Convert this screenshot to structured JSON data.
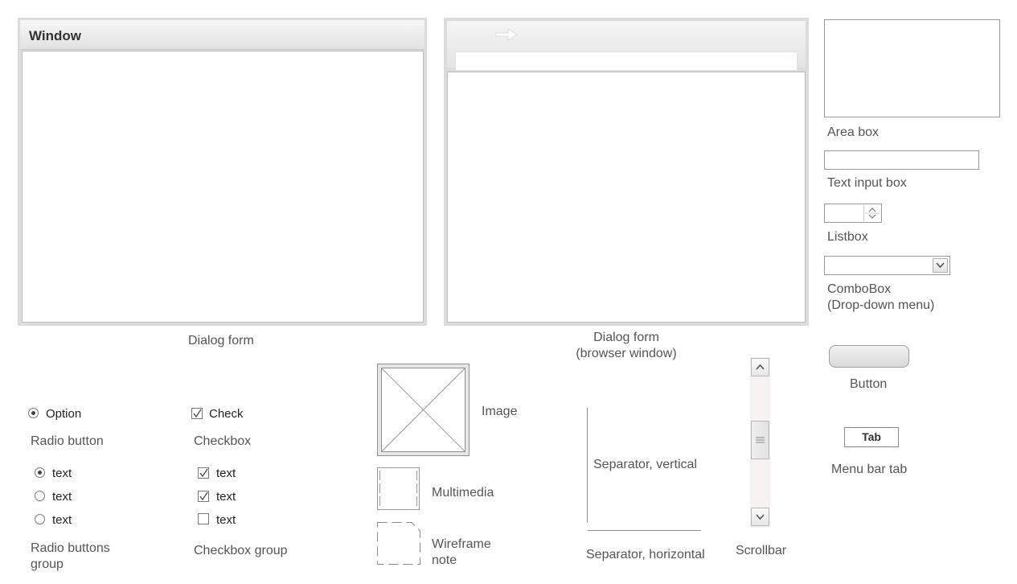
{
  "window_dialog": {
    "title": "Window",
    "caption": "Dialog form"
  },
  "browser_dialog": {
    "caption_line1": "Dialog form",
    "caption_line2": "(browser window)"
  },
  "area_box": {
    "caption": "Area box"
  },
  "text_input": {
    "caption": "Text input box"
  },
  "listbox": {
    "caption": "Listbox"
  },
  "combobox": {
    "caption_line1": "ComboBox",
    "caption_line2": "(Drop-down menu)"
  },
  "button": {
    "caption": "Button"
  },
  "menu_tab": {
    "label": "Tab",
    "caption": "Menu bar tab"
  },
  "radio_button": {
    "label": "Option",
    "selected": true,
    "caption": "Radio button"
  },
  "radio_group": {
    "items": [
      {
        "label": "text",
        "selected": true
      },
      {
        "label": "text",
        "selected": false
      },
      {
        "label": "text",
        "selected": false
      }
    ],
    "caption_line1": "Radio buttons",
    "caption_line2": "group"
  },
  "checkbox": {
    "label": "Check",
    "checked": true,
    "caption": "Checkbox"
  },
  "checkbox_group": {
    "items": [
      {
        "label": "text",
        "checked": true
      },
      {
        "label": "text",
        "checked": true
      },
      {
        "label": "text",
        "checked": false
      }
    ],
    "caption": "Checkbox group"
  },
  "image": {
    "caption": "Image"
  },
  "multimedia": {
    "caption": "Multimedia"
  },
  "wireframe_note": {
    "caption_line1": "Wireframe",
    "caption_line2": "note"
  },
  "separator_vertical": {
    "caption": "Separator, vertical"
  },
  "separator_horizontal": {
    "caption": "Separator, horizontal"
  },
  "scrollbar": {
    "caption": "Scrollbar"
  }
}
